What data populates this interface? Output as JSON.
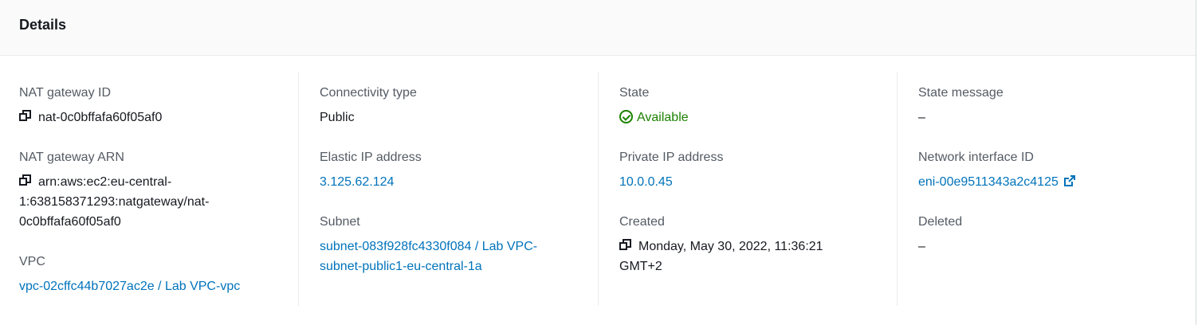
{
  "header": {
    "title": "Details"
  },
  "columns": [
    {
      "fields": [
        {
          "label": "NAT gateway ID",
          "value": "nat-0c0bffafa60f05af0"
        },
        {
          "label": "NAT gateway ARN",
          "value_lines": [
            "arn:aws:ec2:eu-central-",
            "1:638158371293:natgateway/nat-",
            "0c0bffafa60f05af0"
          ]
        },
        {
          "label": "VPC",
          "value": "vpc-02cffc44b7027ac2e / Lab VPC-vpc"
        }
      ]
    },
    {
      "fields": [
        {
          "label": "Connectivity type",
          "value": "Public"
        },
        {
          "label": "Elastic IP address",
          "value": "3.125.62.124"
        },
        {
          "label": "Subnet",
          "value_lines": [
            "subnet-083f928fc4330f084 / Lab VPC-",
            "subnet-public1-eu-central-1a"
          ]
        }
      ]
    },
    {
      "fields": [
        {
          "label": "State",
          "value": "Available"
        },
        {
          "label": "Private IP address",
          "value": "10.0.0.45"
        },
        {
          "label": "Created",
          "value_lines": [
            "Monday, May 30, 2022, 11:36:21",
            "GMT+2"
          ]
        }
      ]
    },
    {
      "fields": [
        {
          "label": "State message",
          "value": "–"
        },
        {
          "label": "Network interface ID",
          "value": "eni-00e9511343a2c4125"
        },
        {
          "label": "Deleted",
          "value": "–"
        }
      ]
    }
  ],
  "icons": {
    "copy": "copy-icon",
    "status_success": "status-positive-icon",
    "external": "external-link-icon"
  },
  "colors": {
    "link": "#0073bb",
    "success": "#1d8102",
    "label": "#545b64",
    "text": "#16191f"
  }
}
